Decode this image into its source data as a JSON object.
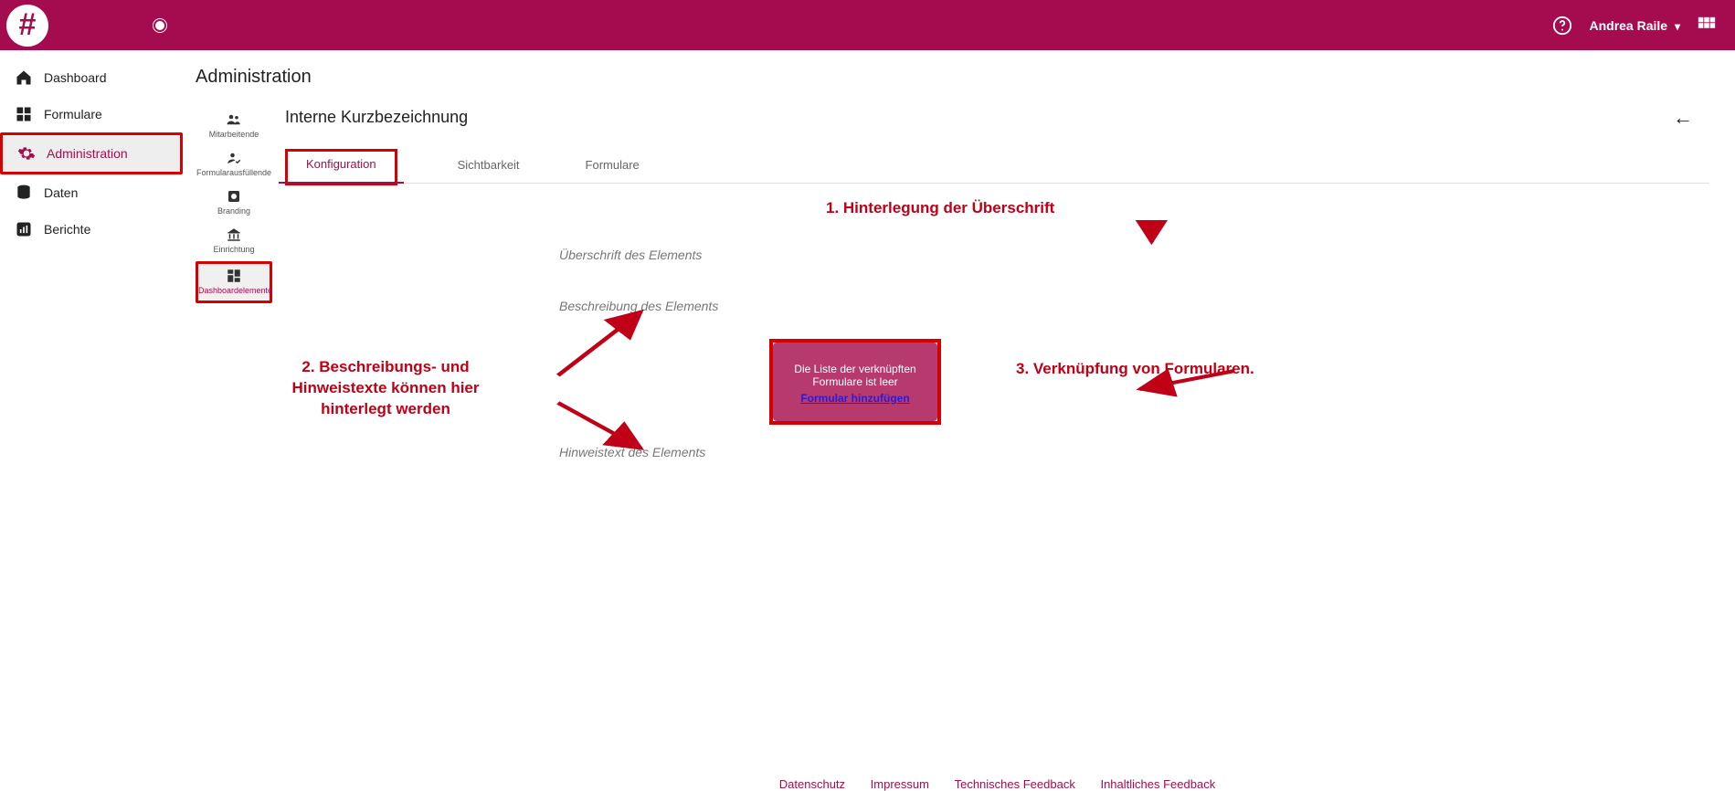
{
  "header": {
    "username": "Andrea Raile"
  },
  "sidebar": {
    "items": [
      {
        "label": "Dashboard",
        "icon": "home"
      },
      {
        "label": "Formulare",
        "icon": "grid"
      },
      {
        "label": "Administration",
        "icon": "gear",
        "active": true
      },
      {
        "label": "Daten",
        "icon": "db"
      },
      {
        "label": "Berichte",
        "icon": "chart"
      }
    ]
  },
  "page": {
    "title": "Administration",
    "section": "Interne Kurzbezeichnung"
  },
  "subnav": {
    "items": [
      {
        "label": "Mitarbeitende"
      },
      {
        "label": "Formularausfüllende"
      },
      {
        "label": "Branding"
      },
      {
        "label": "Einrichtung"
      },
      {
        "label": "Dashboardelemente",
        "active": true
      }
    ]
  },
  "tabs": {
    "items": [
      {
        "label": "Konfiguration",
        "active": true
      },
      {
        "label": "Sichtbarkeit"
      },
      {
        "label": "Formulare"
      }
    ]
  },
  "placeholders": {
    "heading": "Überschrift des Elements",
    "description": "Beschreibung des Elements",
    "hint": "Hinweistext des Elements"
  },
  "forms_box": {
    "empty_text": "Die Liste der verknüpften Formulare ist leer",
    "add_link": "Formular hinzufügen"
  },
  "annotations": {
    "a1": "1. Hinterlegung der Überschrift",
    "a2": "2. Beschreibungs- und Hinweistexte können hier hinterlegt werden",
    "a3": "3. Verknüpfung von Formularen."
  },
  "footer": {
    "links": [
      "Datenschutz",
      "Impressum",
      "Technisches Feedback",
      "Inhaltliches Feedback"
    ]
  }
}
